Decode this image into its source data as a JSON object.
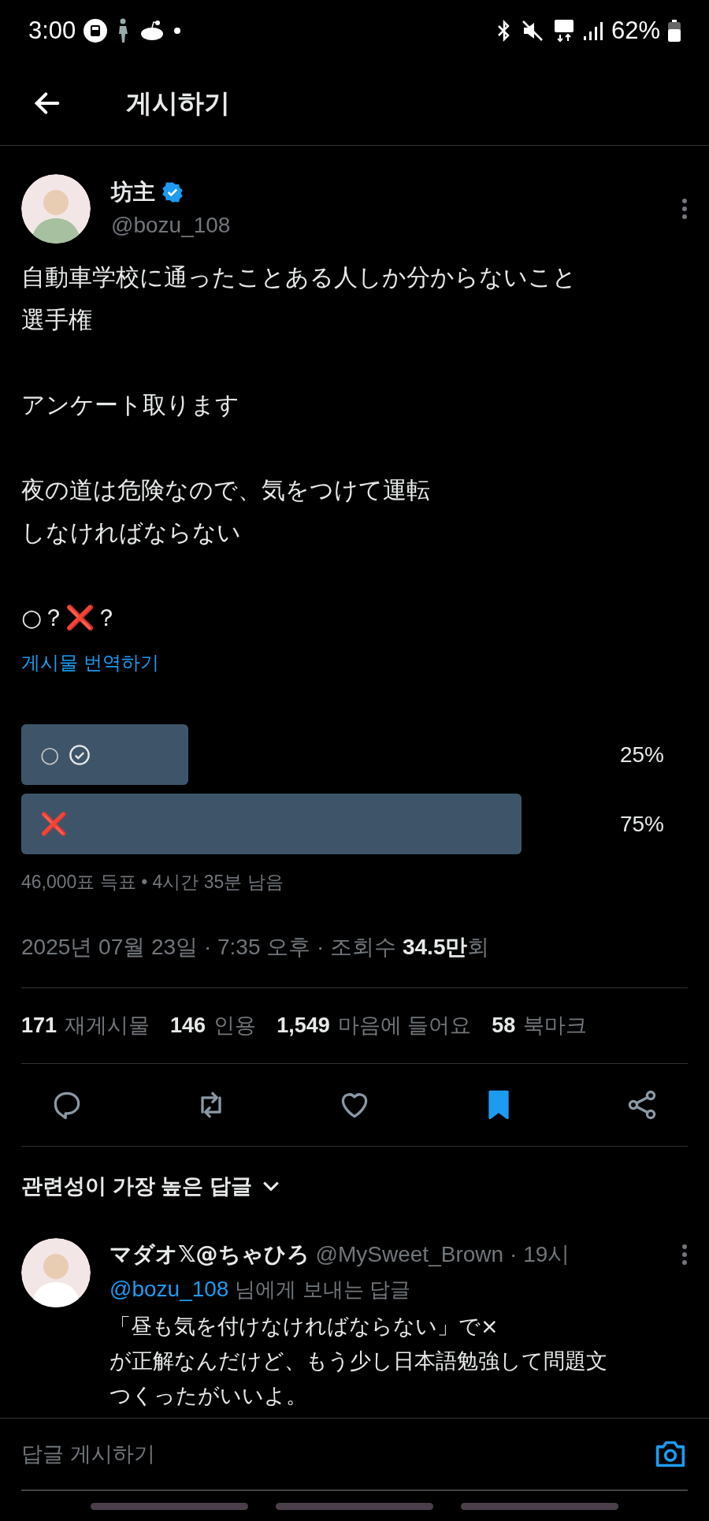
{
  "status_bar": {
    "time": "3:00",
    "battery": "62%"
  },
  "header": {
    "title": "게시하기"
  },
  "post": {
    "author": {
      "name": "坊主",
      "handle": "@bozu_108",
      "verified": true
    },
    "paragraphs": [
      [
        "自動車学校に通ったことある人しか分からないこと",
        "選手権"
      ],
      [
        "アンケート取ります"
      ],
      [
        "夜の道は危険なので、気をつけて運転",
        "しなければならない"
      ],
      [
        "○？❌？"
      ]
    ],
    "translate_link": "게시물 번역하기",
    "poll": {
      "options": [
        {
          "label": "○",
          "voted": true,
          "percent": "25%"
        },
        {
          "label": "❌",
          "voted": false,
          "percent": "75%"
        }
      ],
      "meta": "46,000표 득표 • 4시간 35분 남음"
    },
    "timestamp": "2025년 07월 23일 · 7:35 오후 · 조회수 **34.5만**회",
    "stats": [
      {
        "count": "171",
        "label": "재게시물"
      },
      {
        "count": "146",
        "label": "인용"
      },
      {
        "count": "1,549",
        "label": "마음에 들어요"
      },
      {
        "count": "58",
        "label": "북마크"
      }
    ],
    "actions": [
      {
        "kind": "reply",
        "active": false
      },
      {
        "kind": "repost",
        "active": false
      },
      {
        "kind": "like",
        "active": false
      },
      {
        "kind": "bookmark",
        "active": true
      },
      {
        "kind": "share",
        "active": false
      }
    ]
  },
  "replies_sort": "관련성이 가장 높은 답글",
  "replies": [
    {
      "name": "マダオ𝕏@ちゃひろ",
      "handle": "@MySweet_Brown",
      "time": "· 19시",
      "reply_to": "@bozu_108",
      "reply_to_suffix": "님에게 보내는 답글",
      "lines": [
        "「昼も気を付けなければならない」で×",
        "が正解なんだけど、もう少し日本語勉強して問題文",
        "つくったがいいよ。"
      ]
    }
  ],
  "composer": {
    "placeholder": "답글 게시하기"
  }
}
